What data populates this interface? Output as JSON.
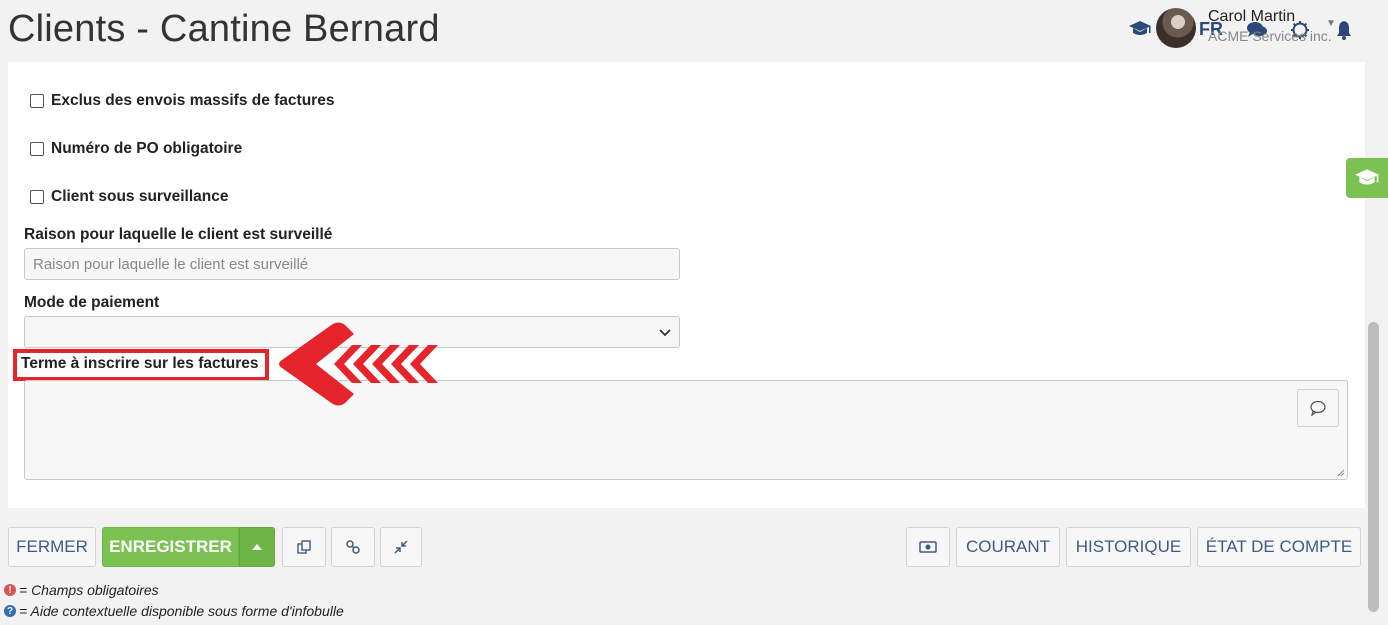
{
  "header": {
    "title": "Clients - Cantine Bernard",
    "language": "FR",
    "user_name": "Carol Martin",
    "user_company": "ACME Services inc."
  },
  "form": {
    "checkboxes": [
      {
        "label": "Exclus des envois massifs de factures",
        "checked": false
      },
      {
        "label": "Numéro de PO obligatoire",
        "checked": false
      },
      {
        "label": "Client sous surveillance",
        "checked": false
      }
    ],
    "reason_label": "Raison pour laquelle le client est surveillé",
    "reason_placeholder": "Raison pour laquelle le client est surveillé",
    "reason_value": "",
    "payment_label": "Mode de paiement",
    "payment_value": "",
    "invoice_term_label": "Terme à inscrire sur les factures",
    "invoice_term_value": ""
  },
  "toolbar": {
    "close_label": "FERMER",
    "save_label": "ENREGISTRER",
    "current_label": "COURANT",
    "history_label": "HISTORIQUE",
    "statement_label": "ÉTAT DE COMPTE"
  },
  "legend": {
    "required": "= Champs obligatoires",
    "help": "= Aide contextuelle disponible sous forme d'infobulle",
    "required_symbol": "!",
    "help_symbol": "?"
  },
  "colors": {
    "accent_green": "#7cc252",
    "highlight_red": "#e5252b",
    "nav_blue": "#2a4a78"
  },
  "icons": {
    "header": [
      "graduation-cap-icon",
      "chat-icon",
      "settings-icon",
      "bell-icon",
      "chevron-down-icon"
    ],
    "toolbar": [
      "caret-up-icon",
      "copy-icon",
      "link-icon",
      "compress-icon",
      "money-icon"
    ]
  }
}
